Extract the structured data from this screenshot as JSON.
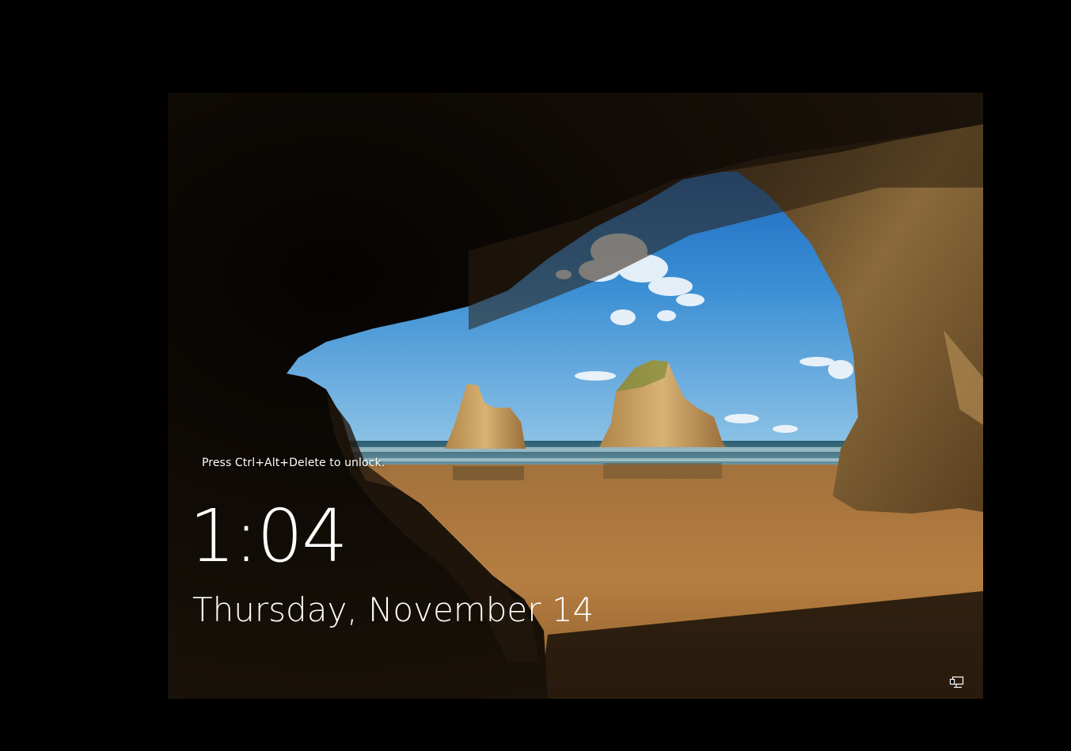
{
  "lock_screen": {
    "unlock_hint": "Press Ctrl+Alt+Delete to unlock.",
    "time": "1:04",
    "date": "Thursday, November 14"
  },
  "icons": {
    "network": "network-icon"
  },
  "colors": {
    "text": "#ffffff",
    "background": "#000000",
    "sky": "#2f7fd0",
    "sand": "#b07a3c",
    "rock": "#2a1d10"
  }
}
